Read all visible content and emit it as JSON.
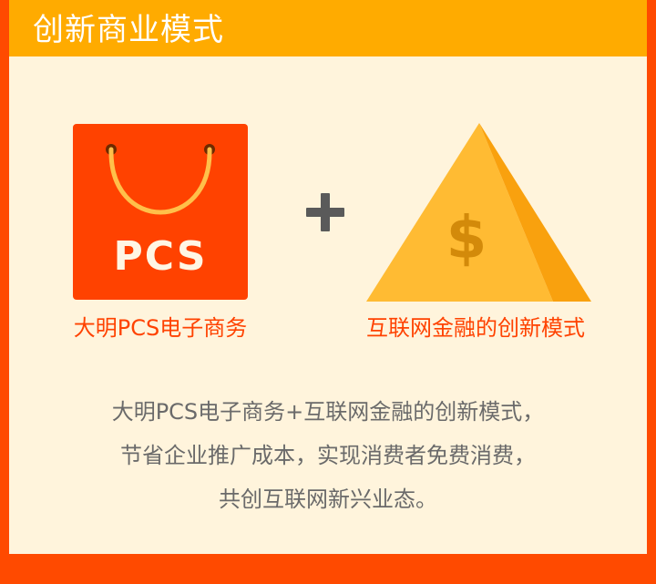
{
  "header": {
    "title": "创新商业模式"
  },
  "colors": {
    "frame": "#ff4a00",
    "header_bar": "#ffab00",
    "content_bg": "#fff4dc",
    "bag": "#ff4200",
    "handle": "#ffc04a",
    "pyramid_light": "#ffbb33",
    "pyramid_dark": "#f9a10e",
    "dollar": "#d38a0a",
    "plus": "#5a5a5a",
    "caption": "#ff4200",
    "description": "#6a6a6a"
  },
  "left_item": {
    "icon": "shopping-bag-icon",
    "icon_label": "PCS",
    "caption": "大明PCS电子商务"
  },
  "operator": {
    "icon": "plus-icon"
  },
  "right_item": {
    "icon": "pyramid-dollar-icon",
    "icon_label": "$",
    "caption": "互联网金融的创新模式"
  },
  "description": {
    "lines": [
      "大明PCS电子商务+互联网金融的创新模式，",
      "节省企业推广成本，实现消费者免费消费，",
      "共创互联网新兴业态。"
    ]
  }
}
